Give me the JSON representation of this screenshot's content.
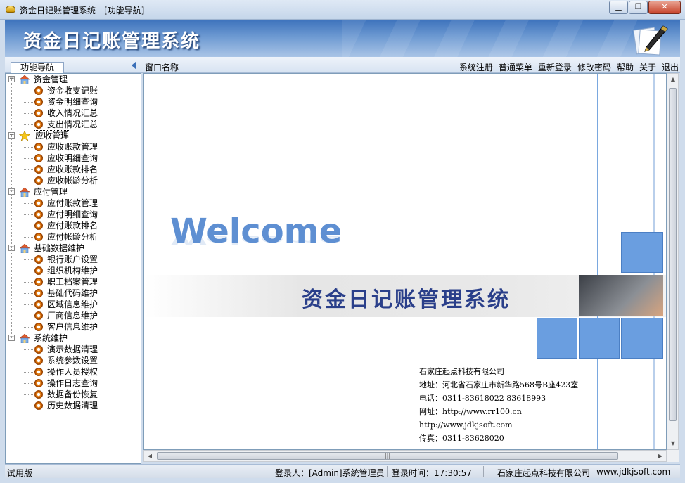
{
  "window": {
    "title": "资金日记账管理系统 - [功能导航]"
  },
  "banner": {
    "title": "资金日记账管理系统"
  },
  "nav": {
    "tab_label": "功能导航",
    "window_name_label": "窗口名称"
  },
  "menu": [
    "系统注册",
    "普通菜单",
    "重新登录",
    "修改密码",
    "帮助",
    "关于",
    "退出"
  ],
  "tree": [
    {
      "label": "资金管理",
      "icon": "house-icon",
      "items": [
        "资金收支记账",
        "资金明细查询",
        "收入情况汇总",
        "支出情况汇总"
      ]
    },
    {
      "label": "应收管理",
      "icon": "star-icon",
      "selected": true,
      "items": [
        "应收账款管理",
        "应收明细查询",
        "应收账款排名",
        "应收帐龄分析"
      ]
    },
    {
      "label": "应付管理",
      "icon": "house-icon",
      "items": [
        "应付账款管理",
        "应付明细查询",
        "应付账款排名",
        "应付帐龄分析"
      ]
    },
    {
      "label": "基础数据维护",
      "icon": "house-icon",
      "items": [
        "银行账户设置",
        "组织机构维护",
        "职工档案管理",
        "基础代码维护",
        "区域信息维护",
        "厂商信息维护",
        "客户信息维护"
      ]
    },
    {
      "label": "系统维护",
      "icon": "house-icon",
      "items": [
        "演示数据清理",
        "系统参数设置",
        "操作人员授权",
        "操作日志查询",
        "数据备份恢复",
        "历史数据清理"
      ]
    }
  ],
  "welcome": {
    "heading": "Welcome",
    "system_name": "资金日记账管理系统",
    "company_name": "石家庄起点科技有限公司",
    "address": "地址：河北省石家庄市新华路568号B座423室",
    "phone": "电话：0311-83618022  83618993",
    "website1": "网址：http://www.rr100.cn",
    "website2": "http://www.jdkjsoft.com",
    "fax": "传真：0311-83628020"
  },
  "status": {
    "edition": "试用版",
    "login_user": "登录人：[Admin]系统管理员",
    "login_time": "登录时间：17:30:57",
    "company": "石家庄起点科技有限公司",
    "site": "www.jdkjsoft.com"
  },
  "colors": {
    "banner": "#3f74bd",
    "tile": "#6a9ee0",
    "welcome": "#5e8fd2",
    "band_title": "#2a3f8a"
  }
}
